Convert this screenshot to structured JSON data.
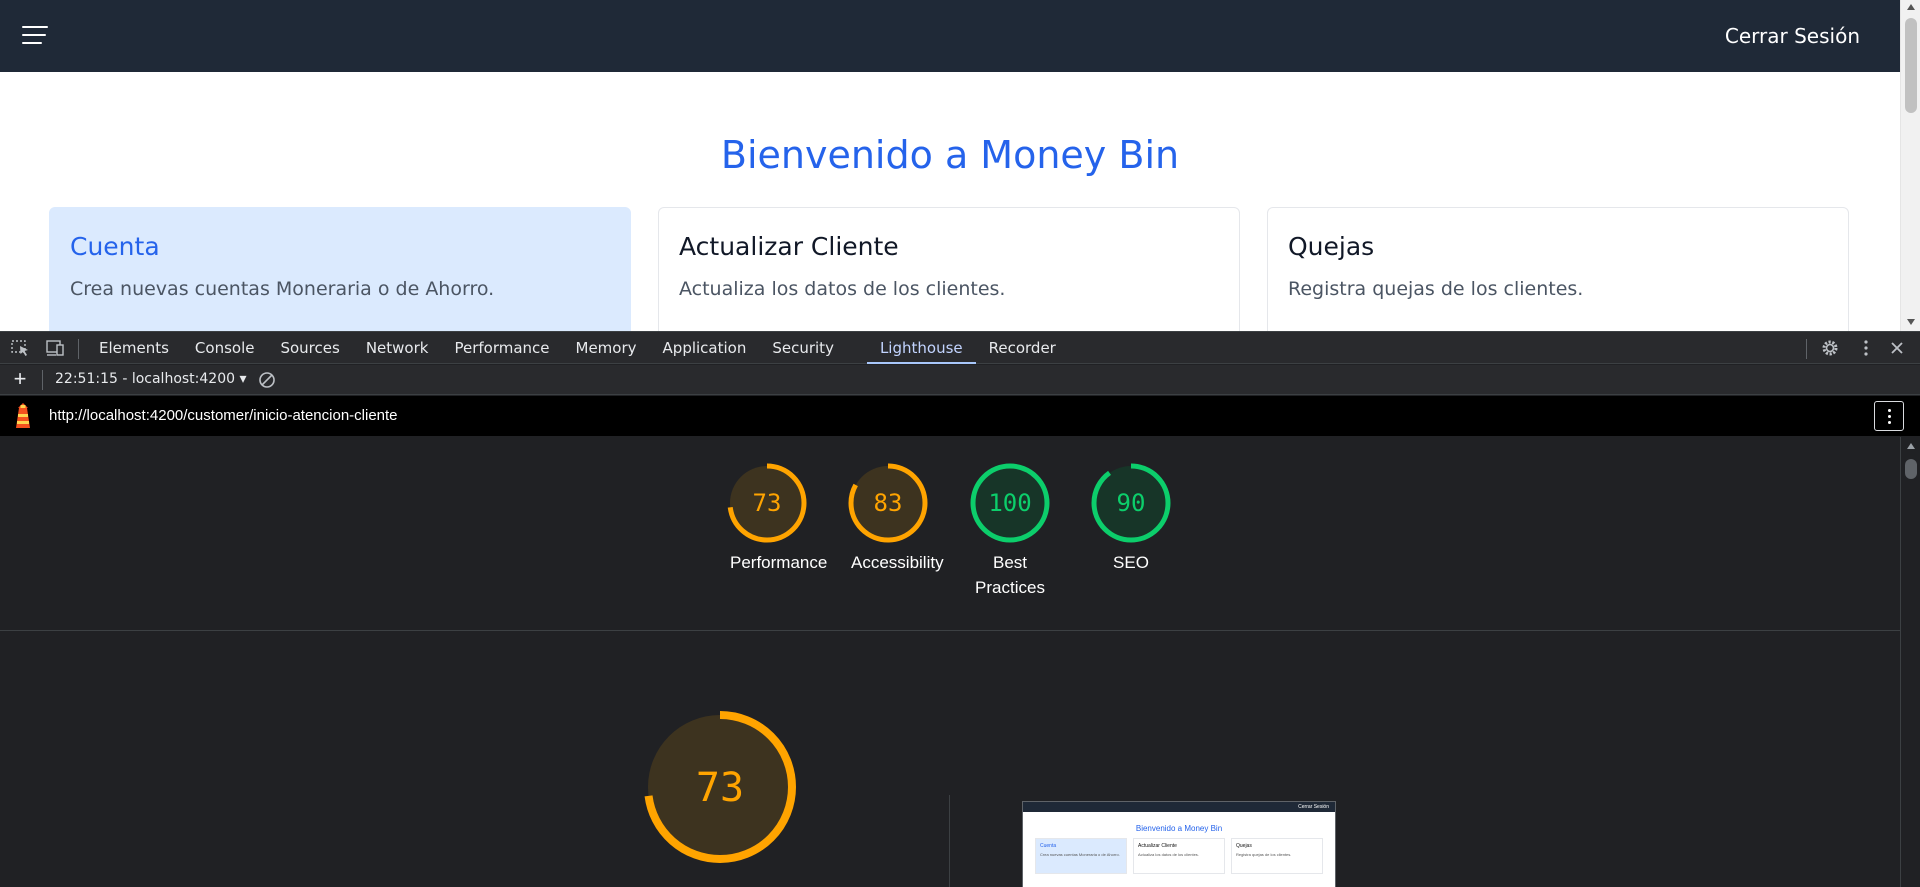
{
  "app": {
    "navbar": {
      "logout_label": "Cerrar Sesión"
    },
    "welcome_title": "Bienvenido a Money Bin",
    "cards": [
      {
        "title": "Cuenta",
        "description": "Crea nuevas cuentas Moneraria o de Ahorro.",
        "active": true
      },
      {
        "title": "Actualizar Cliente",
        "description": "Actualiza los datos de los clientes.",
        "active": false
      },
      {
        "title": "Quejas",
        "description": "Registra quejas de los clientes.",
        "active": false
      }
    ]
  },
  "devtools": {
    "tabs": [
      "Elements",
      "Console",
      "Sources",
      "Network",
      "Performance",
      "Memory",
      "Application",
      "Security",
      "Lighthouse",
      "Recorder"
    ],
    "active_tab": "Lighthouse",
    "report_selector": "22:51:15 - localhost:4200",
    "url": "http://localhost:4200/customer/inicio-atencion-cliente",
    "colors": {
      "average": "#ffa400",
      "pass": "#0cce6b",
      "accent": "#a8c7fa"
    },
    "scores": [
      {
        "label": "Performance",
        "value": 73,
        "fraction": 0.73,
        "rating": "average"
      },
      {
        "label": "Accessibility",
        "value": 83,
        "fraction": 0.83,
        "rating": "average"
      },
      {
        "label": "Best Practices",
        "value": 100,
        "fraction": 1.0,
        "rating": "pass"
      },
      {
        "label": "SEO",
        "value": 90,
        "fraction": 0.9,
        "rating": "pass"
      }
    ],
    "main_score": {
      "value": 73,
      "fraction": 0.73,
      "rating": "average"
    },
    "thumbnail": {
      "title": "Bienvenido a Money Bin",
      "logout_label": "Cerrar Sesión",
      "cards": [
        {
          "title": "Cuenta",
          "description": "Crea nuevas cuentas Moneraria o de Ahorro."
        },
        {
          "title": "Actualizar Cliente",
          "description": "Actualiza los datos de los clientes."
        },
        {
          "title": "Quejas",
          "description": "Registra quejas de los clientes."
        }
      ]
    }
  }
}
